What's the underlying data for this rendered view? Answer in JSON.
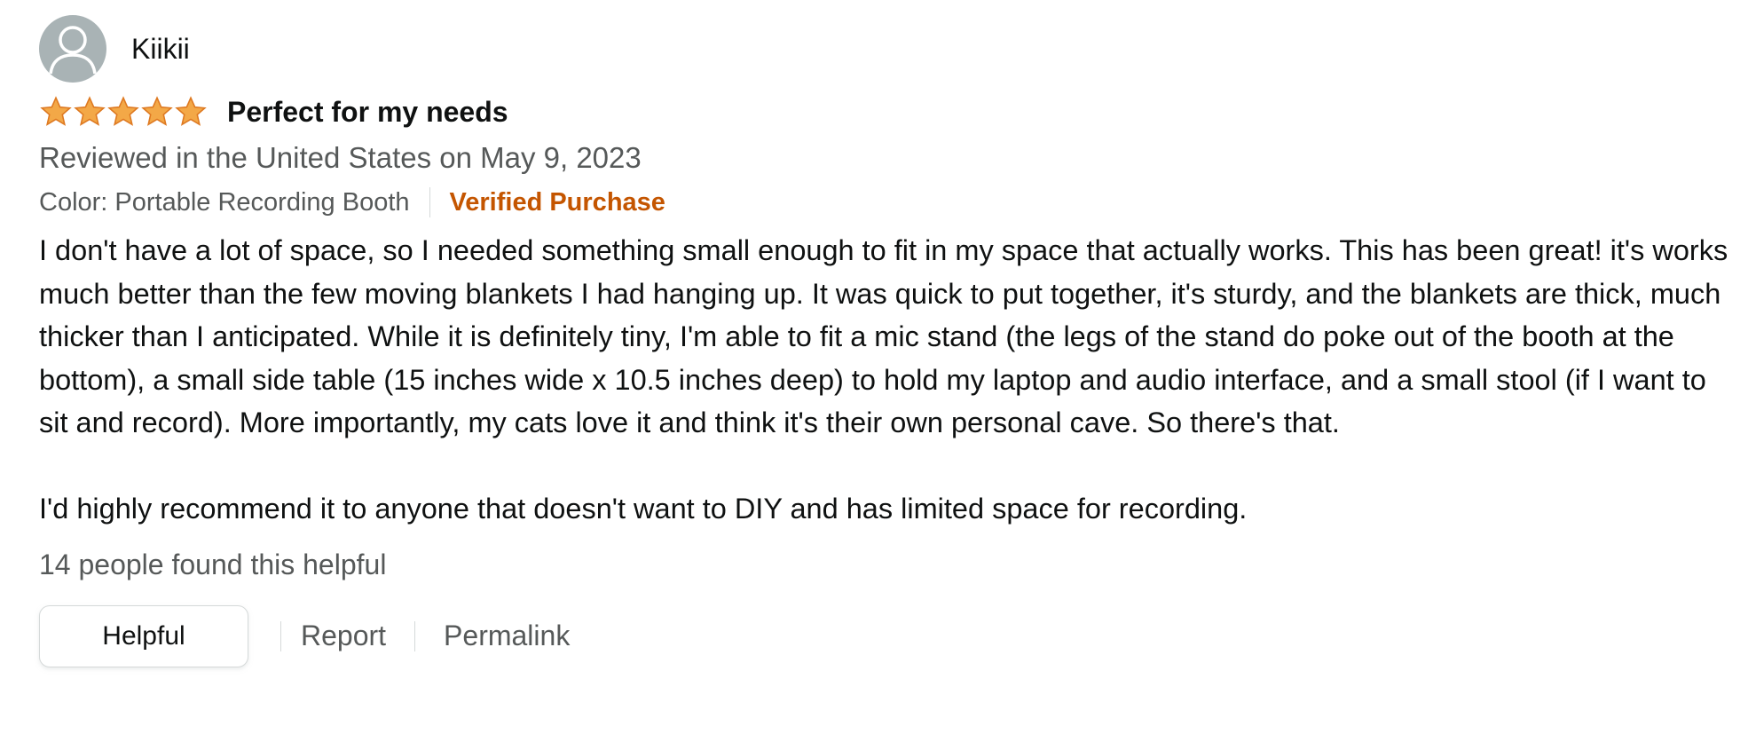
{
  "review": {
    "profile": {
      "name": "Kiikii",
      "avatar_icon": "default-user-avatar-icon"
    },
    "rating": {
      "stars": 5,
      "max": 5,
      "star_color": "#f3a847",
      "star_stroke": "#de7921"
    },
    "title": "Perfect for my needs",
    "date": "Reviewed in the United States on May 9, 2023",
    "format": "Color: Portable Recording Booth",
    "verified": "Verified Purchase",
    "body": [
      "I don't have a lot of space, so I needed something small enough to fit in my space that actually works. This has been great! it's works much better than the few moving blankets I had hanging up. It was quick to put together, it's sturdy, and the blankets are thick, much thicker than I anticipated. While it is definitely tiny, I'm able to fit a mic stand (the legs of the stand do poke out of the booth at the bottom), a small side table (15 inches wide x 10.5 inches deep) to hold my laptop and audio interface, and a small stool (if I want to sit and record). More importantly, my cats love it and think it's their own personal cave. So there's that.",
      "I'd highly recommend it to anyone that doesn't want to DIY and has limited space for recording."
    ],
    "helpful_count": "14 people found this helpful",
    "actions": {
      "helpful": "Helpful",
      "report": "Report",
      "permalink": "Permalink"
    }
  },
  "colors": {
    "text": "#0f1111",
    "secondary": "#565959",
    "verified": "#c45500",
    "border": "#d5d9d9"
  }
}
